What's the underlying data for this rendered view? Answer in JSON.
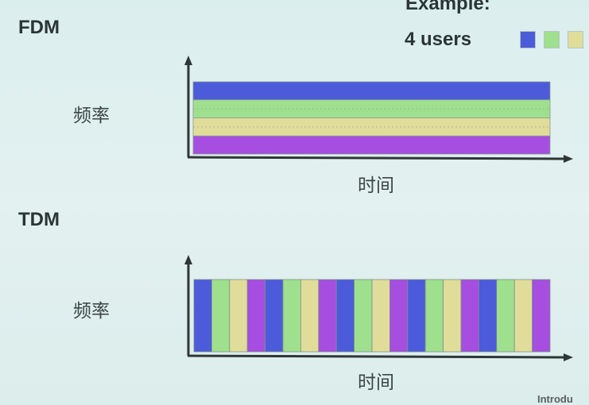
{
  "legend": {
    "title": "Example:",
    "caption": "4 users",
    "colors": [
      "#4b5bd9",
      "#9ee08e",
      "#e0dd9a",
      "#a54ee0"
    ]
  },
  "fdm": {
    "heading": "FDM",
    "y_label": "频率",
    "x_label": "时间",
    "bands": [
      "#4b5bd9",
      "#9ee08e",
      "#e0dd9a",
      "#a54ee0"
    ]
  },
  "tdm": {
    "heading": "TDM",
    "y_label": "频率",
    "x_label": "时间",
    "slots": [
      "#4b5bd9",
      "#9ee08e",
      "#e0dd9a",
      "#a54ee0",
      "#4b5bd9",
      "#9ee08e",
      "#e0dd9a",
      "#a54ee0",
      "#4b5bd9",
      "#9ee08e",
      "#e0dd9a",
      "#a54ee0",
      "#4b5bd9",
      "#9ee08e",
      "#e0dd9a",
      "#a54ee0",
      "#4b5bd9",
      "#9ee08e",
      "#e0dd9a",
      "#a54ee0"
    ]
  },
  "footer": "Introdu"
}
